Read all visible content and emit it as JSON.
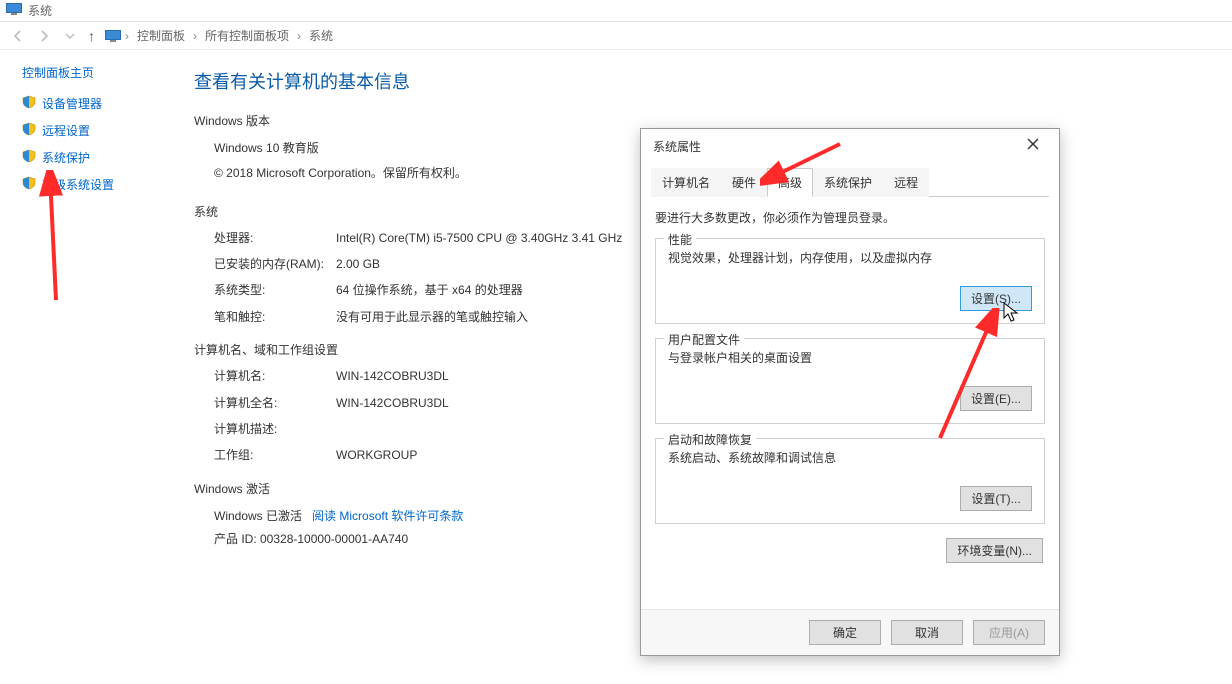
{
  "window_title": "系统",
  "nav": {
    "up_symbol": "↑"
  },
  "breadcrumb": {
    "items": [
      "控制面板",
      "所有控制面板项",
      "系统"
    ],
    "sep": "›"
  },
  "sidebar": {
    "home": "控制面板主页",
    "items": [
      {
        "label": "设备管理器"
      },
      {
        "label": "远程设置"
      },
      {
        "label": "系统保护"
      },
      {
        "label": "高级系统设置"
      }
    ]
  },
  "content": {
    "heading": "查看有关计算机的基本信息",
    "win_edition_title": "Windows 版本",
    "win_edition": "Windows 10 教育版",
    "copyright": "© 2018 Microsoft Corporation。保留所有权利。",
    "system_title": "系统",
    "system": {
      "cpu_label": "处理器:",
      "cpu_value": "Intel(R) Core(TM) i5-7500 CPU @ 3.40GHz   3.41 GHz",
      "ram_label": "已安装的内存(RAM):",
      "ram_value": "2.00 GB",
      "type_label": "系统类型:",
      "type_value": "64 位操作系统，基于 x64 的处理器",
      "pen_label": "笔和触控:",
      "pen_value": "没有可用于此显示器的笔或触控输入"
    },
    "computer_title": "计算机名、域和工作组设置",
    "computer": {
      "name_label": "计算机名:",
      "name_value": "WIN-142COBRU3DL",
      "full_label": "计算机全名:",
      "full_value": "WIN-142COBRU3DL",
      "desc_label": "计算机描述:",
      "desc_value": "",
      "wg_label": "工作组:",
      "wg_value": "WORKGROUP"
    },
    "activation_title": "Windows 激活",
    "activation": {
      "status": "Windows 已激活",
      "link": "阅读 Microsoft 软件许可条款",
      "pid": "产品 ID: 00328-10000-00001-AA740"
    }
  },
  "dialog": {
    "title": "系统属性",
    "tabs": [
      "计算机名",
      "硬件",
      "高级",
      "系统保护",
      "远程"
    ],
    "selected_tab_index": 2,
    "admin_note": "要进行大多数更改，你必须作为管理员登录。",
    "performance": {
      "legend": "性能",
      "desc": "视觉效果，处理器计划，内存使用，以及虚拟内存",
      "button": "设置(S)..."
    },
    "user_profile": {
      "legend": "用户配置文件",
      "desc": "与登录帐户相关的桌面设置",
      "button": "设置(E)..."
    },
    "startup": {
      "legend": "启动和故障恢复",
      "desc": "系统启动、系统故障和调试信息",
      "button": "设置(T)..."
    },
    "env_button": "环境变量(N)...",
    "footer": {
      "ok": "确定",
      "cancel": "取消",
      "apply": "应用(A)"
    }
  }
}
